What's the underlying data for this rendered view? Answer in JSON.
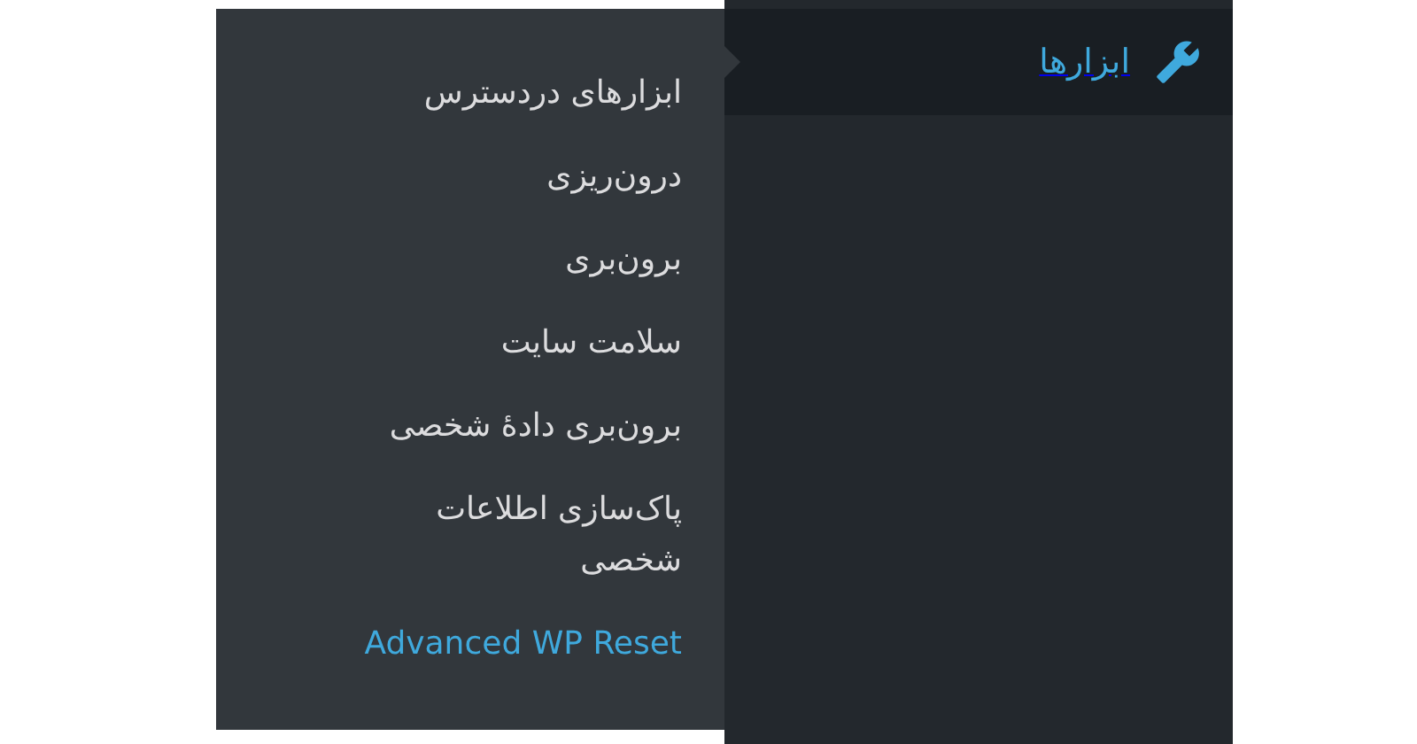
{
  "menu": {
    "label": "ابزارها",
    "selected": true
  },
  "submenu": [
    {
      "label": "ابزارهای دردسترس",
      "selected": false
    },
    {
      "label": "درون‌ریزی",
      "selected": false
    },
    {
      "label": "برون‌بری",
      "selected": false
    },
    {
      "label": "سلامت سایت",
      "selected": false
    },
    {
      "label": "برون‌بری دادهٔ شخصی",
      "selected": false
    },
    {
      "label": "پاک‌سازی اطلاعات شخصی",
      "selected": false
    },
    {
      "label": "Advanced WP Reset",
      "selected": true
    }
  ]
}
